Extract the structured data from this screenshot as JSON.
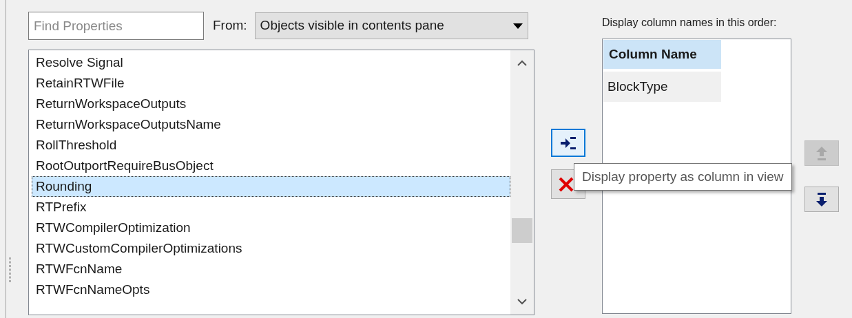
{
  "search": {
    "placeholder": "Find Properties"
  },
  "from_label": "From:",
  "from_dropdown": {
    "value": "Objects visible in contents pane"
  },
  "properties": [
    {
      "label": "Resolve Signal",
      "selected": false
    },
    {
      "label": "RetainRTWFile",
      "selected": false
    },
    {
      "label": "ReturnWorkspaceOutputs",
      "selected": false
    },
    {
      "label": "ReturnWorkspaceOutputsName",
      "selected": false
    },
    {
      "label": "RollThreshold",
      "selected": false
    },
    {
      "label": "RootOutportRequireBusObject",
      "selected": false
    },
    {
      "label": "Rounding",
      "selected": true
    },
    {
      "label": "RTPrefix",
      "selected": false
    },
    {
      "label": "RTWCompilerOptimization",
      "selected": false
    },
    {
      "label": "RTWCustomCompilerOptimizations",
      "selected": false
    },
    {
      "label": "RTWFcnName",
      "selected": false
    },
    {
      "label": "RTWFcnNameOpts",
      "selected": false
    }
  ],
  "columns_label": "Display column names in this order:",
  "columns_table": {
    "header": "Column Name",
    "rows": [
      "BlockType"
    ]
  },
  "move_up": {
    "disabled": true
  },
  "move_down": {
    "disabled": false
  },
  "tooltip": "Display property as column in view"
}
